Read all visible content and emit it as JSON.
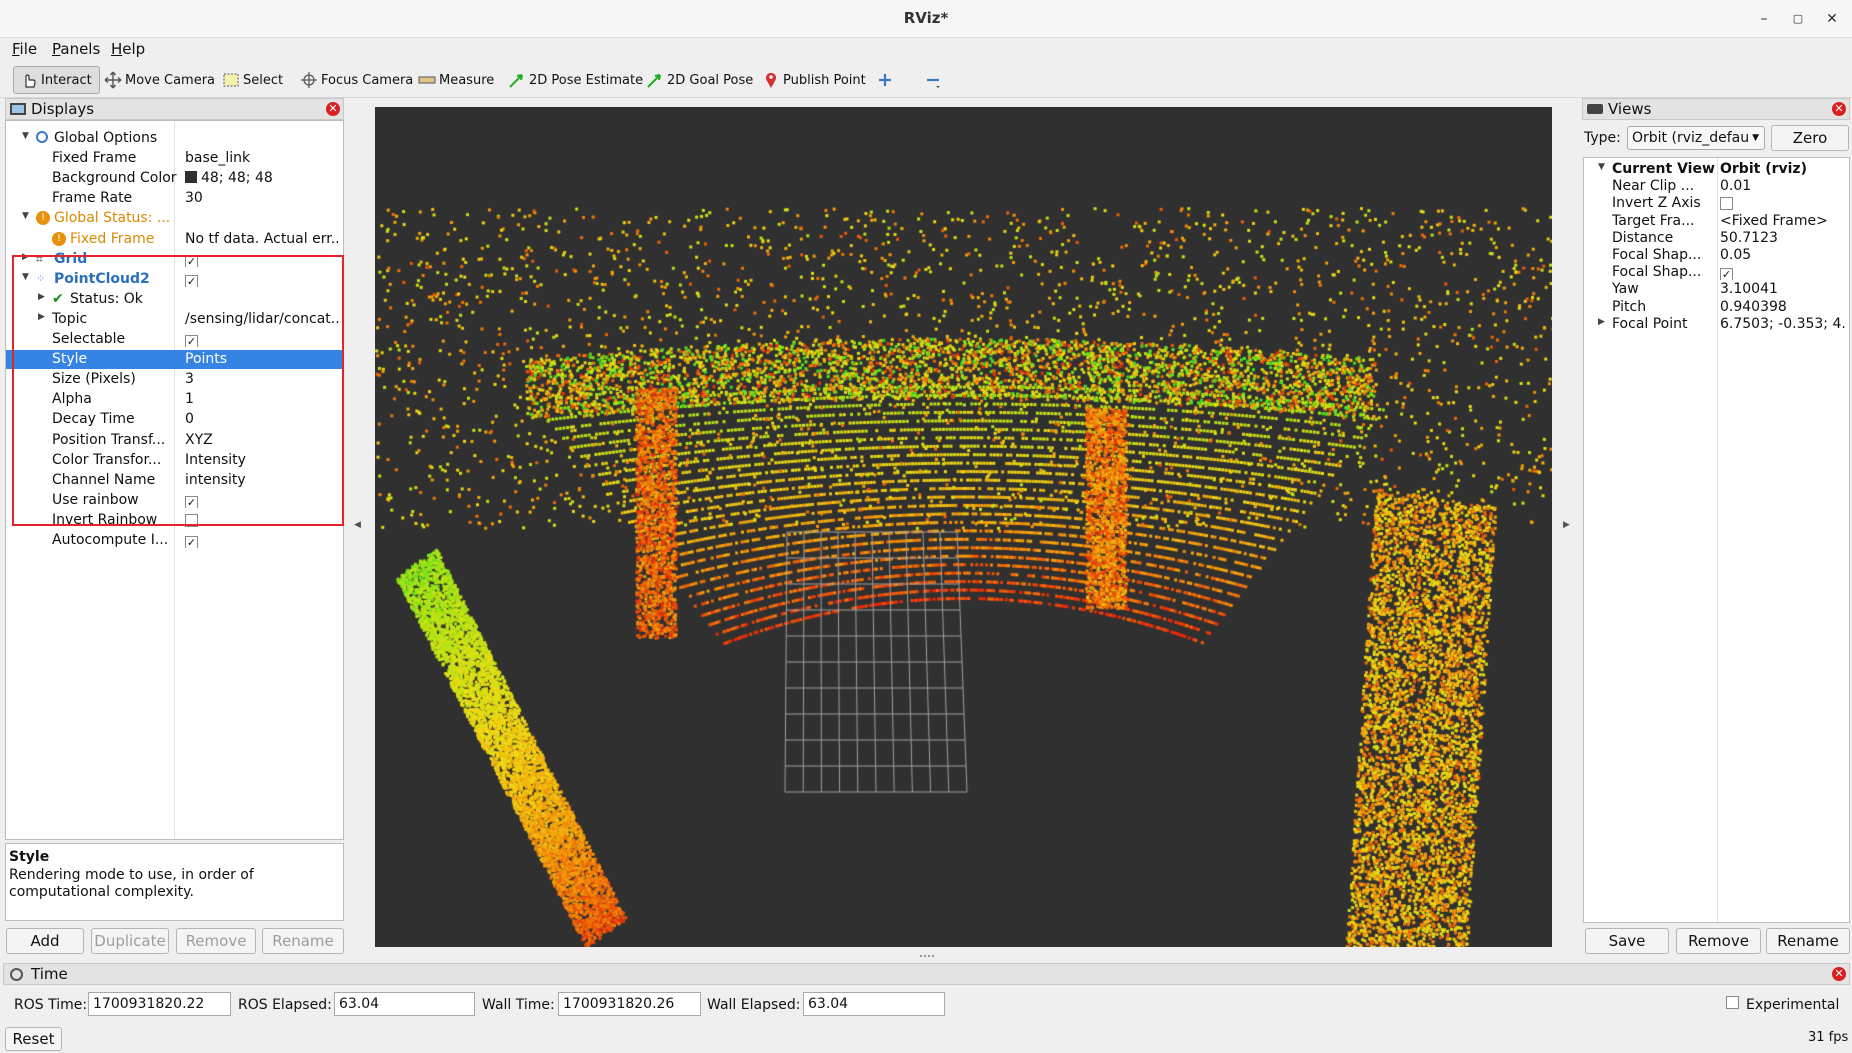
{
  "window": {
    "title": "RViz*"
  },
  "menu": [
    {
      "label": "File",
      "u": "F",
      "rest": "ile"
    },
    {
      "label": "Panels",
      "u": "P",
      "rest": "anels"
    },
    {
      "label": "Help",
      "u": "H",
      "rest": "elp"
    }
  ],
  "toolbar": {
    "interact": "Interact",
    "move_camera": "Move Camera",
    "select": "Select",
    "focus_camera": "Focus Camera",
    "measure": "Measure",
    "pose_estimate": "2D Pose Estimate",
    "goal_pose": "2D Goal Pose",
    "publish_point": "Publish Point"
  },
  "displays": {
    "title": "Displays",
    "rows": [
      {
        "name": "Global Options",
        "value": "",
        "level": 0,
        "expand": "open",
        "icon": "globe-icon"
      },
      {
        "name": "Fixed Frame",
        "value": "base_link",
        "level": 1
      },
      {
        "name": "Background Color",
        "value": "48; 48; 48",
        "level": 1,
        "swatch": "#303030"
      },
      {
        "name": "Frame Rate",
        "value": "30",
        "level": 1
      },
      {
        "name": "Global Status: ...",
        "value": "",
        "level": 0,
        "expand": "open",
        "icon": "warning-icon",
        "color": "#d98a00"
      },
      {
        "name": "Fixed Frame",
        "value": "No tf data.  Actual err...",
        "level": 1,
        "icon": "warning-icon",
        "color": "#d98a00"
      },
      {
        "name": "Grid",
        "value": "",
        "level": 0,
        "expand": "closed",
        "icon": "grid-icon",
        "check": true,
        "color": "#2a6fbd",
        "bold": true
      },
      {
        "name": "PointCloud2",
        "value": "",
        "level": 0,
        "expand": "open",
        "icon": "pointcloud-icon",
        "check": true,
        "color": "#2a6fbd",
        "bold": true
      },
      {
        "name": "Status: Ok",
        "value": "",
        "level": 1,
        "expand": "closed",
        "icon": "checkmark-icon"
      },
      {
        "name": "Topic",
        "value": "/sensing/lidar/concat...",
        "level": 1,
        "expand": "closed"
      },
      {
        "name": "Selectable",
        "value": "",
        "level": 1,
        "check": true
      },
      {
        "name": "Style",
        "value": "Points",
        "level": 1,
        "selected": true
      },
      {
        "name": "Size (Pixels)",
        "value": "3",
        "level": 1
      },
      {
        "name": "Alpha",
        "value": "1",
        "level": 1
      },
      {
        "name": "Decay Time",
        "value": "0",
        "level": 1
      },
      {
        "name": "Position Transf...",
        "value": "XYZ",
        "level": 1
      },
      {
        "name": "Color Transfor...",
        "value": "Intensity",
        "level": 1
      },
      {
        "name": "Channel Name",
        "value": "intensity",
        "level": 1
      },
      {
        "name": "Use rainbow",
        "value": "",
        "level": 1,
        "check": true
      },
      {
        "name": "Invert Rainbow",
        "value": "",
        "level": 1,
        "check": false
      },
      {
        "name": "Autocompute I...",
        "value": "",
        "level": 1,
        "check": true
      }
    ],
    "help_title": "Style",
    "help_text": "Rendering mode to use, in order of computational complexity.",
    "buttons": {
      "add": "Add",
      "duplicate": "Duplicate",
      "remove": "Remove",
      "rename": "Rename"
    }
  },
  "views": {
    "title": "Views",
    "type_label": "Type:",
    "type_value": "Orbit (rviz_defau",
    "zero": "Zero",
    "rows": [
      {
        "name": "Current View",
        "value": "Orbit (rviz)",
        "bold": true,
        "expand": "open"
      },
      {
        "name": "Near Clip ...",
        "value": "0.01"
      },
      {
        "name": "Invert Z Axis",
        "value": "",
        "check": false
      },
      {
        "name": "Target Fra...",
        "value": "<Fixed Frame>"
      },
      {
        "name": "Distance",
        "value": "50.7123"
      },
      {
        "name": "Focal Shap...",
        "value": "0.05"
      },
      {
        "name": "Focal Shap...",
        "value": "",
        "check": true
      },
      {
        "name": "Yaw",
        "value": "3.10041"
      },
      {
        "name": "Pitch",
        "value": "0.940398"
      },
      {
        "name": "Focal Point",
        "value": "6.7503; -0.353; 4...",
        "expand": "closed"
      }
    ],
    "buttons": {
      "save": "Save",
      "remove": "Remove",
      "rename": "Rename"
    }
  },
  "time": {
    "title": "Time",
    "ros_time_label": "ROS Time:",
    "ros_time": "1700931820.22",
    "ros_elapsed_label": "ROS Elapsed:",
    "ros_elapsed": "63.04",
    "wall_time_label": "Wall Time:",
    "wall_time": "1700931820.26",
    "wall_elapsed_label": "Wall Elapsed:",
    "wall_elapsed": "63.04",
    "experimental": "Experimental",
    "reset": "Reset",
    "fps": "31 fps"
  },
  "colors": {
    "selection": "#3584e4",
    "highlight_box": "#e0252b",
    "background": "#303030"
  }
}
